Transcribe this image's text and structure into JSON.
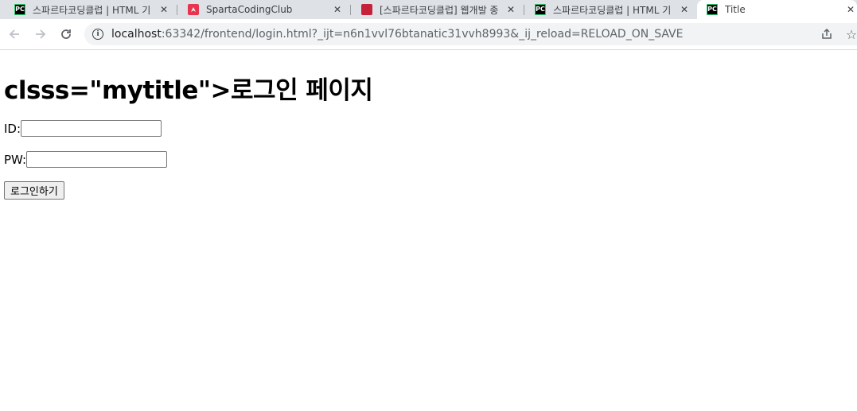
{
  "browser": {
    "tabs": [
      {
        "title": "스파르타코딩클럽 | HTML 기",
        "favicon": "pycharm-icon",
        "active": false
      },
      {
        "title": "SpartaCodingClub",
        "favicon": "spartacodingclub-icon",
        "active": false
      },
      {
        "title": "[스파르타코딩클럽] 웹개발 종",
        "favicon": "book-icon",
        "active": false
      },
      {
        "title": "스파르타코딩클럽 | HTML 기",
        "favicon": "pycharm-icon",
        "active": false
      },
      {
        "title": "Title",
        "favicon": "pycharm-icon",
        "active": true
      }
    ],
    "favicon_text": "PC",
    "address": {
      "host": "localhost",
      "rest": ":63342/frontend/login.html?_ijt=n6n1vvl76btanatic31vvh8993&_ij_reload=RELOAD_ON_SAVE"
    }
  },
  "page": {
    "heading": "clsss=\"mytitle\">로그인 페이지",
    "id_label": "ID:",
    "id_value": "",
    "pw_label": "PW:",
    "pw_value": "",
    "login_button": "로그인하기"
  }
}
